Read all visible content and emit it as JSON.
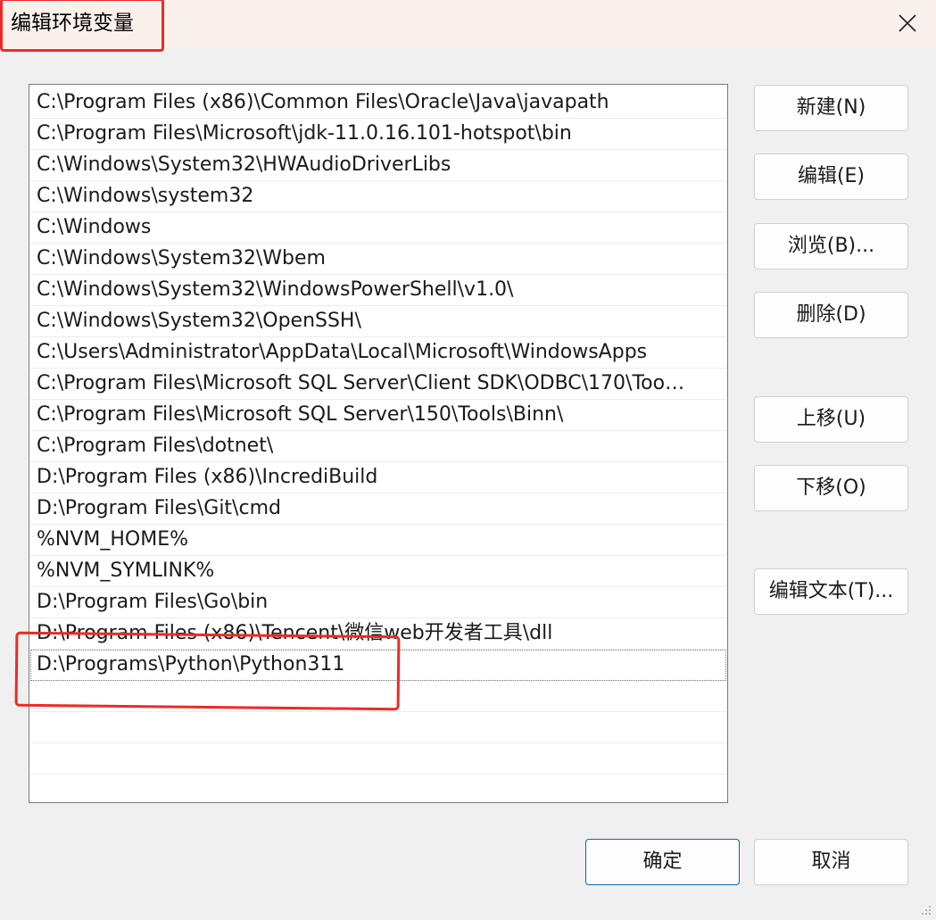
{
  "window": {
    "title": "编辑环境变量",
    "close_icon": "close-icon"
  },
  "list": {
    "items": [
      "C:\\Program Files (x86)\\Common Files\\Oracle\\Java\\javapath",
      "C:\\Program Files\\Microsoft\\jdk-11.0.16.101-hotspot\\bin",
      "C:\\Windows\\System32\\HWAudioDriverLibs",
      "C:\\Windows\\system32",
      "C:\\Windows",
      "C:\\Windows\\System32\\Wbem",
      "C:\\Windows\\System32\\WindowsPowerShell\\v1.0\\",
      "C:\\Windows\\System32\\OpenSSH\\",
      "C:\\Users\\Administrator\\AppData\\Local\\Microsoft\\WindowsApps",
      "C:\\Program Files\\Microsoft SQL Server\\Client SDK\\ODBC\\170\\Too…",
      "C:\\Program Files\\Microsoft SQL Server\\150\\Tools\\Binn\\",
      "C:\\Program Files\\dotnet\\",
      "D:\\Program Files (x86)\\IncrediBuild",
      "D:\\Program Files\\Git\\cmd",
      "%NVM_HOME%",
      "%NVM_SYMLINK%",
      "D:\\Program Files\\Go\\bin",
      "D:\\Program Files (x86)\\Tencent\\微信web开发者工具\\dll",
      "D:\\Programs\\Python\\Python311",
      "",
      "",
      "",
      ""
    ],
    "selected_index": 18
  },
  "buttons": {
    "new": "新建(N)",
    "edit": "编辑(E)",
    "browse": "浏览(B)...",
    "delete": "删除(D)",
    "move_up": "上移(U)",
    "move_down": "下移(O)",
    "edit_text": "编辑文本(T)...",
    "ok": "确定",
    "cancel": "取消"
  },
  "colors": {
    "annotation_red": "#ee2a24",
    "accent_blue": "#0067c0"
  }
}
